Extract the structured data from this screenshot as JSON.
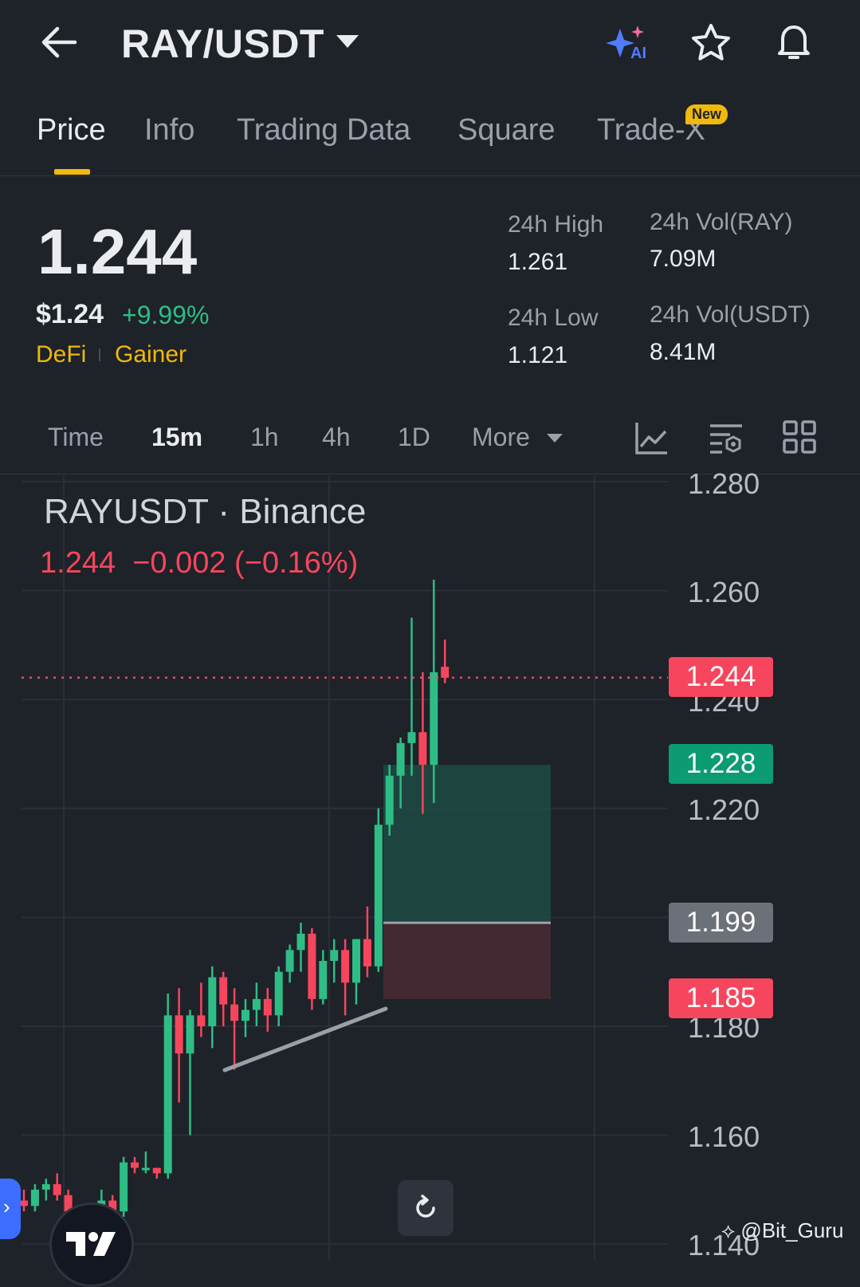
{
  "header": {
    "pair": "RAY/USDT",
    "ai_label": "AI"
  },
  "tabs": [
    {
      "label": "Price",
      "active": true
    },
    {
      "label": "Info"
    },
    {
      "label": "Trading Data"
    },
    {
      "label": "Square"
    },
    {
      "label": "Trade-X",
      "badge": "New"
    }
  ],
  "ticker": {
    "last_price": "1.244",
    "usd_price": "$1.24",
    "change_pct": "+9.99%",
    "tags": [
      "DeFi",
      "Gainer"
    ],
    "high_label": "24h High",
    "high_value": "1.261",
    "low_label": "24h Low",
    "low_value": "1.121",
    "vol_base_label": "24h Vol(RAY)",
    "vol_base_value": "7.09M",
    "vol_quote_label": "24h Vol(USDT)",
    "vol_quote_value": "8.41M"
  },
  "intervals": {
    "items": [
      "Time",
      "15m",
      "1h",
      "4h",
      "1D",
      "More"
    ],
    "active": "15m"
  },
  "chart": {
    "title": "RAYUSDT · Binance",
    "ohlc_price": "1.244",
    "ohlc_change": "−0.002 (−0.16%)",
    "axis_labels": [
      "1.280",
      "1.260",
      "1.240",
      "1.220",
      "1.180",
      "1.160",
      "1.140"
    ],
    "price_tags": [
      {
        "value": "1.244",
        "color": "#f6465d"
      },
      {
        "value": "1.228",
        "color": "#0c9b72"
      },
      {
        "value": "1.199",
        "color": "#6b7079"
      },
      {
        "value": "1.185",
        "color": "#f6465d"
      }
    ],
    "watermark": "@Bit_Guru"
  },
  "colors": {
    "up": "#2ebd85",
    "down": "#f6465d",
    "accent": "#f0b90b",
    "background": "#1e2229"
  },
  "chart_data": {
    "type": "candlestick",
    "title": "RAYUSDT · Binance",
    "y_range": [
      1.14,
      1.28
    ],
    "last_price": 1.244,
    "y_ticks": [
      1.28,
      1.26,
      1.24,
      1.22,
      1.18,
      1.16,
      1.14
    ],
    "position_overlay": {
      "entry": 1.199,
      "take_profit": 1.228,
      "stop_loss": 1.185
    },
    "candles": [
      {
        "o": 1.148,
        "h": 1.15,
        "l": 1.146,
        "c": 1.147
      },
      {
        "o": 1.147,
        "h": 1.151,
        "l": 1.146,
        "c": 1.15
      },
      {
        "o": 1.15,
        "h": 1.152,
        "l": 1.148,
        "c": 1.151
      },
      {
        "o": 1.151,
        "h": 1.153,
        "l": 1.148,
        "c": 1.149
      },
      {
        "o": 1.149,
        "h": 1.15,
        "l": 1.144,
        "c": 1.146
      },
      {
        "o": 1.14,
        "h": 1.145,
        "l": 1.139,
        "c": 1.142
      },
      {
        "o": 1.142,
        "h": 1.144,
        "l": 1.14,
        "c": 1.143
      },
      {
        "o": 1.145,
        "h": 1.15,
        "l": 1.143,
        "c": 1.148
      },
      {
        "o": 1.148,
        "h": 1.149,
        "l": 1.145,
        "c": 1.146
      },
      {
        "o": 1.146,
        "h": 1.156,
        "l": 1.145,
        "c": 1.155
      },
      {
        "o": 1.155,
        "h": 1.156,
        "l": 1.153,
        "c": 1.154
      },
      {
        "o": 1.154,
        "h": 1.157,
        "l": 1.153,
        "c": 1.154
      },
      {
        "o": 1.154,
        "h": 1.154,
        "l": 1.152,
        "c": 1.153
      },
      {
        "o": 1.153,
        "h": 1.186,
        "l": 1.152,
        "c": 1.182
      },
      {
        "o": 1.182,
        "h": 1.187,
        "l": 1.166,
        "c": 1.175
      },
      {
        "o": 1.175,
        "h": 1.183,
        "l": 1.16,
        "c": 1.182
      },
      {
        "o": 1.182,
        "h": 1.188,
        "l": 1.178,
        "c": 1.18
      },
      {
        "o": 1.18,
        "h": 1.191,
        "l": 1.176,
        "c": 1.189
      },
      {
        "o": 1.189,
        "h": 1.19,
        "l": 1.18,
        "c": 1.184
      },
      {
        "o": 1.184,
        "h": 1.187,
        "l": 1.172,
        "c": 1.181
      },
      {
        "o": 1.181,
        "h": 1.185,
        "l": 1.178,
        "c": 1.183
      },
      {
        "o": 1.183,
        "h": 1.188,
        "l": 1.18,
        "c": 1.185
      },
      {
        "o": 1.185,
        "h": 1.187,
        "l": 1.179,
        "c": 1.182
      },
      {
        "o": 1.182,
        "h": 1.191,
        "l": 1.18,
        "c": 1.19
      },
      {
        "o": 1.19,
        "h": 1.195,
        "l": 1.188,
        "c": 1.194
      },
      {
        "o": 1.194,
        "h": 1.199,
        "l": 1.19,
        "c": 1.197
      },
      {
        "o": 1.197,
        "h": 1.198,
        "l": 1.183,
        "c": 1.185
      },
      {
        "o": 1.185,
        "h": 1.194,
        "l": 1.184,
        "c": 1.192
      },
      {
        "o": 1.192,
        "h": 1.196,
        "l": 1.188,
        "c": 1.194
      },
      {
        "o": 1.194,
        "h": 1.196,
        "l": 1.182,
        "c": 1.188
      },
      {
        "o": 1.188,
        "h": 1.196,
        "l": 1.184,
        "c": 1.196
      },
      {
        "o": 1.196,
        "h": 1.202,
        "l": 1.189,
        "c": 1.191
      },
      {
        "o": 1.191,
        "h": 1.22,
        "l": 1.19,
        "c": 1.217
      },
      {
        "o": 1.217,
        "h": 1.228,
        "l": 1.215,
        "c": 1.226
      },
      {
        "o": 1.226,
        "h": 1.233,
        "l": 1.22,
        "c": 1.232
      },
      {
        "o": 1.232,
        "h": 1.255,
        "l": 1.226,
        "c": 1.234
      },
      {
        "o": 1.234,
        "h": 1.245,
        "l": 1.219,
        "c": 1.228
      },
      {
        "o": 1.228,
        "h": 1.262,
        "l": 1.221,
        "c": 1.245
      },
      {
        "o": 1.246,
        "h": 1.251,
        "l": 1.243,
        "c": 1.244
      }
    ]
  }
}
